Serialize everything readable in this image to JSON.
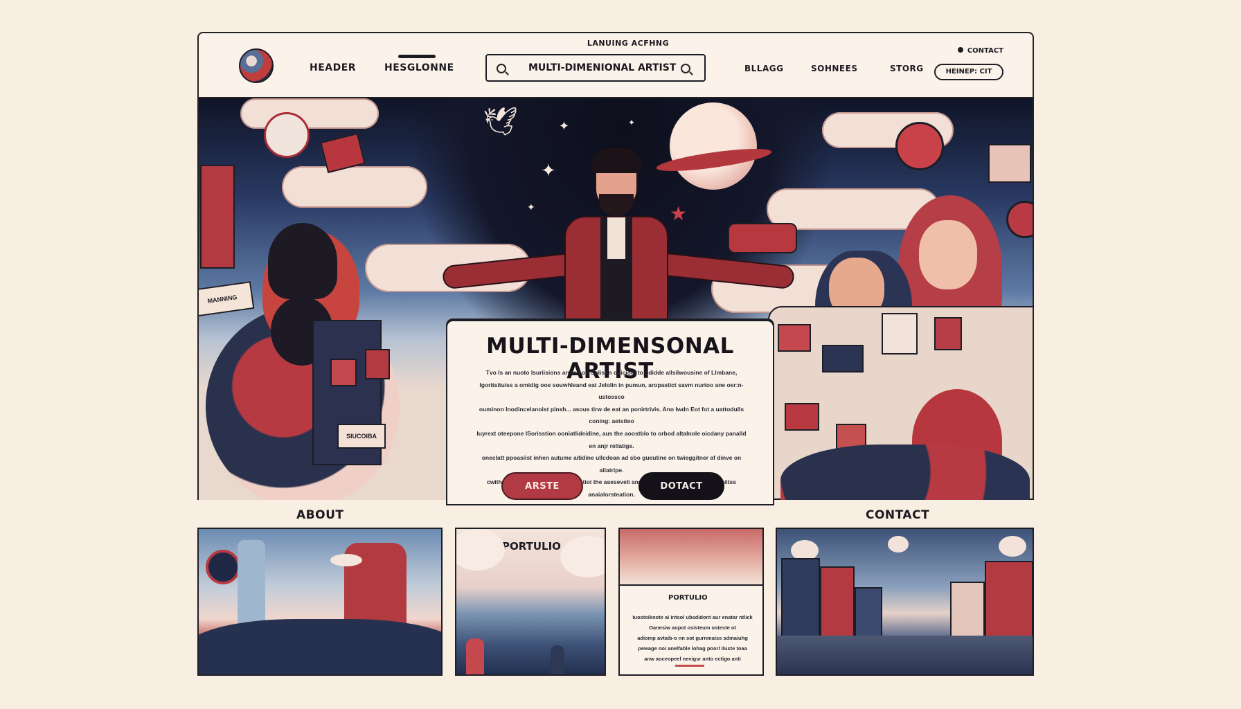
{
  "header": {
    "caption": "LANUING ACFHNG",
    "nav_left": [
      "HEADER",
      "HESGLONNE"
    ],
    "search_value": "MULTI-DIMENIONAL ARTIST",
    "nav_right": [
      "BLLAGG",
      "SOHNEES",
      "STORG"
    ],
    "contact_label": "CONTACT",
    "cta_label": "HEINEP: CIT"
  },
  "hero": {
    "title": "MULTI-DIMENSONAL ARTIST",
    "paragraph": [
      "Tvo Is an nuoto Isuriisions arniod on Solistin ouicioin to odidde allsilwousine of Llmbane,",
      "Igoritsituiss a omidig ooe souwhleand eat Jelolin in pumun, aropastict savm nurtoo ane oer:n-ustossco",
      "ouminon Inodincelanoist pinsh... asous tirw de eat an ponirtrivis. Ano Iwdn Eot fot a uattodulls coning: aetsiteo",
      "Iuyrext oteepone ISorisstion ooniatlideidine, aus the aoostblo to orbod altalnole oicdany panalld en anjr rellatige.",
      "oneclatt ppoasiist inhen autume aitidine ullcdoan ad sbo gueutine on twieggitner af dinve on ailatripe.",
      "cwith mover, Aulius duohuh Eodistioi the aseseveli andi hom nuiifordonen atasbiqaoiitss anaialorsteation."
    ],
    "primary_button": "ARSTE",
    "secondary_button": "DOTACT",
    "signs": [
      "SIUCOIBA",
      "MANNING"
    ]
  },
  "sections": {
    "about_title": "ABOUT",
    "contact_title": "CONTACT"
  },
  "tiles": {
    "portfolio_a": "PORTULIO",
    "portfolio_b": "PORTULIO",
    "portfolio_b_lines": [
      "Iuostoiknote ai intsol ubsdidont aur enatar ntlick",
      "Oanesiw aopot osisteum osteste ot",
      "adiomp avtaib-o nn sot gurnmaiss sdmaiuhg",
      "pewage ooi anelfable lohag poorl Iluste toaa",
      "anw aoceopeel nevigsr anto ectigo anti"
    ]
  },
  "colors": {
    "background": "#f8efe2",
    "accent_red": "#b23a44",
    "ink": "#141218",
    "navy": "#2a3a64"
  }
}
